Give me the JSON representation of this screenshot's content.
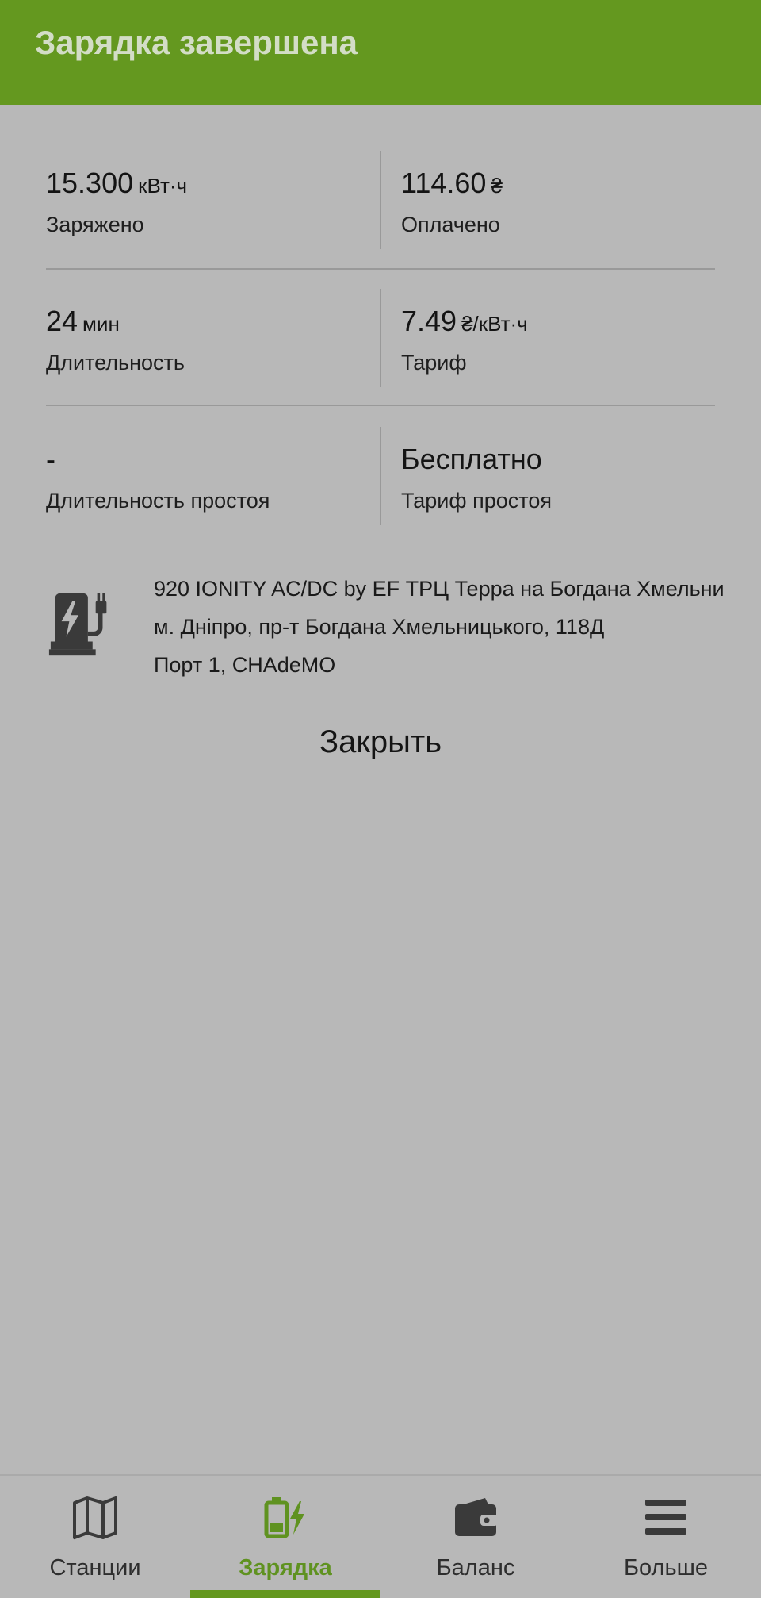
{
  "app_bar": {
    "title": "Зарядка завершена"
  },
  "stats": [
    {
      "left": {
        "value": "15.300",
        "unit": "кВт·ч",
        "label": "Заряжено"
      },
      "right": {
        "value": "114.60",
        "unit": "₴",
        "label": "Оплачено"
      }
    },
    {
      "left": {
        "value": "24",
        "unit": "мин",
        "label": "Длительность"
      },
      "right": {
        "value": "7.49",
        "unit": "₴/кВт·ч",
        "label": "Тариф"
      }
    },
    {
      "left": {
        "value": "-",
        "unit": "",
        "label": "Длительность простоя"
      },
      "right": {
        "value": "Бесплатно",
        "unit": "",
        "label": "Тариф простоя"
      }
    }
  ],
  "station": {
    "icon": "ev-charger-icon",
    "name": "920 IONITY AC/DC by EF ТРЦ Терра на Богдана Хмельни",
    "address": "м. Дніпро, пр-т Богдана Хмельницького, 118Д",
    "port": "Порт 1, CHAdeMO"
  },
  "close_label": "Закрыть",
  "bottom_nav": {
    "items": [
      {
        "label": "Станции",
        "icon": "map-icon",
        "active": false
      },
      {
        "label": "Зарядка",
        "icon": "battery-charging-icon",
        "active": true
      },
      {
        "label": "Баланс",
        "icon": "wallet-icon",
        "active": false
      },
      {
        "label": "Больше",
        "icon": "menu-icon",
        "active": false
      }
    ]
  },
  "colors": {
    "accent": "#64981f",
    "background": "#b8b8b8",
    "title_text": "#d3ddc6",
    "active_label": "#5f9220",
    "icon_gray": "#3a3a3a"
  }
}
